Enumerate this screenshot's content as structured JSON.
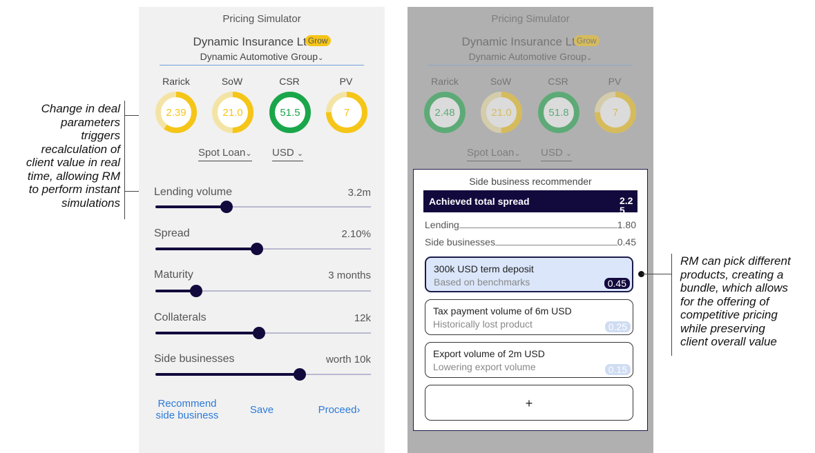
{
  "annotations": {
    "left": [
      "Change in deal",
      "parameters",
      "triggers",
      "recalculation of",
      "client value in real",
      "time, allowing RM",
      "to perform instant",
      "simulations"
    ],
    "right": [
      "RM can pick different",
      "products, creating a",
      "bundle, which allows",
      "for the offering of",
      "competitive pricing",
      "while preserving",
      "client overall value"
    ]
  },
  "simulator": {
    "title": "Pricing Simulator",
    "client": "Dynamic Insurance Lt",
    "badge": "Grow",
    "group": "Dynamic Automotive Group",
    "group_chevron": "chevron-down-icon",
    "kpis": [
      {
        "label": "Rarick",
        "value": "2.39",
        "fraction": 0.6,
        "color": "#f5c518"
      },
      {
        "label": "SoW",
        "value": "21.0",
        "fraction": 0.5,
        "color": "#f5c518"
      },
      {
        "label": "CSR",
        "value": "51.5",
        "fraction": 1.0,
        "color": "#1aa64a"
      },
      {
        "label": "PV",
        "value": "7",
        "fraction": 0.75,
        "color": "#f5c518"
      }
    ],
    "product_select": "Spot Loan",
    "currency_select": "USD",
    "sliders": [
      {
        "label": "Lending volume",
        "value": "3.2m",
        "level": 0.33
      },
      {
        "label": "Spread",
        "value": "2.10%",
        "level": 0.47
      },
      {
        "label": "Maturity",
        "value": "3 months",
        "level": 0.19
      },
      {
        "label": "Collaterals",
        "value": "12k",
        "level": 0.48
      },
      {
        "label": "Side businesses",
        "value": "worth 10k",
        "level": 0.67
      }
    ],
    "actions": {
      "recommend_line1": "Recommend",
      "recommend_line2": "side business",
      "save": "Save",
      "proceed": "Proceed",
      "proceed_icon": "chevron-right-icon"
    }
  },
  "simulator_after": {
    "title": "Pricing Simulator",
    "client": "Dynamic Insurance Lt",
    "badge": "Grow",
    "group": "Dynamic Automotive Group",
    "kpis": [
      {
        "label": "Rarick",
        "value": "2.48",
        "fraction": 1.0,
        "color": "#1aa64a"
      },
      {
        "label": "SoW",
        "value": "21.0",
        "fraction": 0.5,
        "color": "#f5c518"
      },
      {
        "label": "CSR",
        "value": "51.8",
        "fraction": 1.0,
        "color": "#1aa64a"
      },
      {
        "label": "PV",
        "value": "7",
        "fraction": 0.75,
        "color": "#f5c518"
      }
    ],
    "product_select": "Spot Loan",
    "currency_select": "USD"
  },
  "recommender": {
    "title": "Side business recommender",
    "total_label": "Achieved total spread",
    "total_value": "2.25",
    "rows": [
      {
        "label": "Lending",
        "value": "1.80"
      },
      {
        "label": "Side businesses",
        "value": "0.45"
      }
    ],
    "cards": [
      {
        "title": "300k USD term deposit",
        "subtitle": "Based on benchmarks",
        "value": "0.45",
        "selected": true
      },
      {
        "title": "Tax payment volume of 6m USD",
        "subtitle": "Historically lost product",
        "value": "0.25",
        "selected": false
      },
      {
        "title": "Export volume of 2m USD",
        "subtitle": "Lowering export volume",
        "value": "0.15",
        "selected": false
      }
    ],
    "add_label": "+"
  }
}
